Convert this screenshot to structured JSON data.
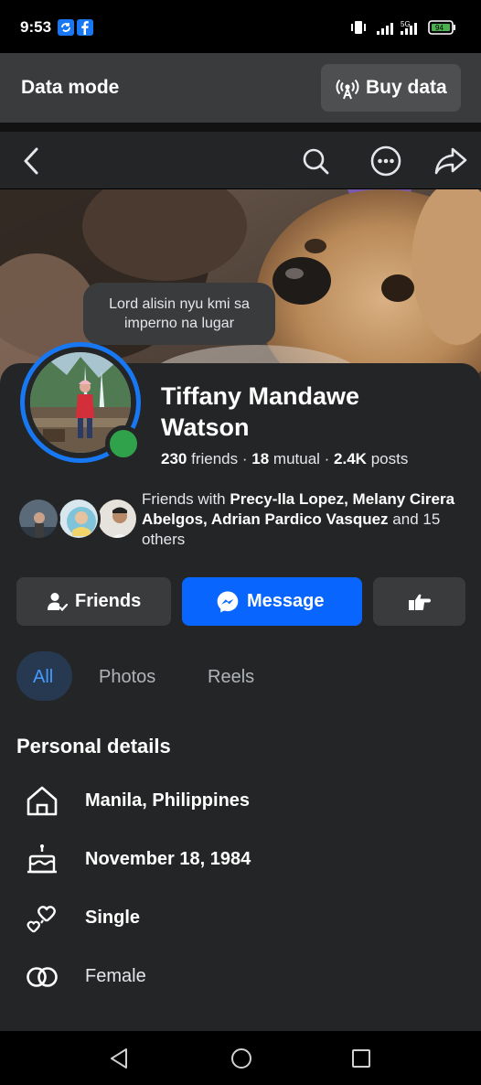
{
  "status_bar": {
    "time": "9:53",
    "battery": "94"
  },
  "data_banner": {
    "mode_label": "Data mode",
    "buy_label": "Buy data"
  },
  "note": {
    "text_line1": "Lord alisin nyu kmi sa",
    "text_line2": "imperno na lugar"
  },
  "profile": {
    "name_line1": "Tiffany Mandawe",
    "name_line2": "Watson",
    "friends_count": "230",
    "friends_label": "friends",
    "mutual_count": "18",
    "mutual_label": "mutual",
    "posts_count": "2.4K",
    "posts_label": "posts",
    "separator": " · "
  },
  "mutual_friends": {
    "prefix": "Friends with ",
    "names": "Precy-lla Lopez, Melany Cirera Abelgos, Adrian Pardico Vasquez",
    "suffix": " and 15 others"
  },
  "actions": {
    "friends_label": "Friends",
    "message_label": "Message"
  },
  "tabs": [
    {
      "label": "All",
      "active": true
    },
    {
      "label": "Photos",
      "active": false
    },
    {
      "label": "Reels",
      "active": false
    }
  ],
  "personal_details": {
    "title": "Personal details",
    "items": [
      {
        "icon": "home-icon",
        "text": "Manila, Philippines"
      },
      {
        "icon": "birthday-cake-icon",
        "text": "November 18, 1984"
      },
      {
        "icon": "relationship-hearts-icon",
        "text": "Single"
      },
      {
        "icon": "gender-icon",
        "text": "Female"
      }
    ]
  },
  "colors": {
    "accent": "#0866ff",
    "online": "#31a24c",
    "card": "#242526",
    "tab_active": "#263951"
  }
}
